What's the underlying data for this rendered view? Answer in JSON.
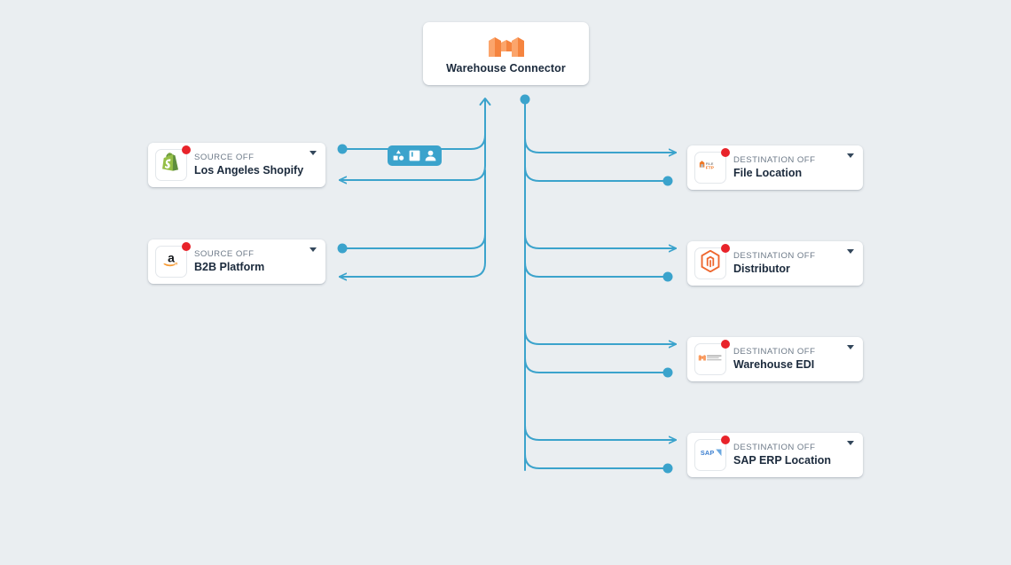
{
  "canvas": {
    "background_color": "#eaeef1",
    "wire_color": "#3ba3cc",
    "accent_orange": "#f58b4c",
    "badge_color": "#e8232a"
  },
  "hub": {
    "label": "Warehouse Connector",
    "icon": "warehouse-connector-logo"
  },
  "wire_toolbar": {
    "icons": [
      "shapes-icon",
      "document-icon",
      "person-icon"
    ]
  },
  "sources": [
    {
      "kicker": "SOURCE OFF",
      "title": "Los Angeles Shopify",
      "icon": "shopify-icon",
      "badge": true,
      "caret": "chevron-down-icon"
    },
    {
      "kicker": "SOURCE OFF",
      "title": "B2B Platform",
      "icon": "amazon-icon",
      "badge": true,
      "caret": "chevron-down-icon"
    }
  ],
  "destinations": [
    {
      "kicker": "DESTINATION OFF",
      "title": "File Location",
      "icon": "file-ftp-icon",
      "badge": true,
      "caret": "chevron-down-icon"
    },
    {
      "kicker": "DESTINATION OFF",
      "title": "Distributor",
      "icon": "magento-icon",
      "badge": true,
      "caret": "chevron-down-icon"
    },
    {
      "kicker": "DESTINATION OFF",
      "title": "Warehouse EDI",
      "icon": "warehouse-connector-wordmark-icon",
      "badge": true,
      "caret": "chevron-down-icon"
    },
    {
      "kicker": "DESTINATION OFF",
      "title": "SAP ERP Location",
      "icon": "sap-icon",
      "badge": true,
      "caret": "chevron-down-icon"
    }
  ]
}
